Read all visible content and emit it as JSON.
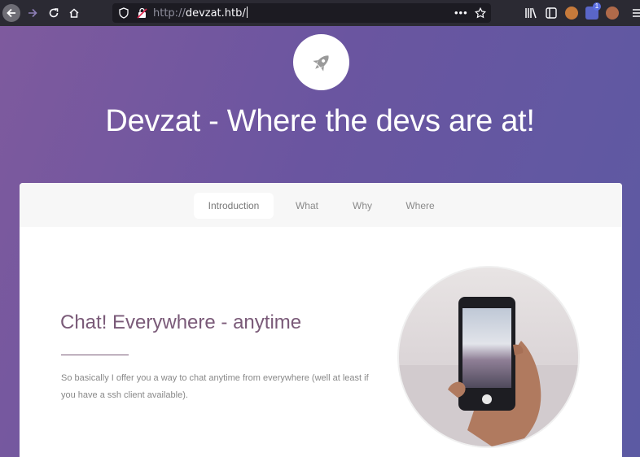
{
  "browser": {
    "url_protocol": "http://",
    "url_host": "devzat.htb/",
    "more_icon": "ellipsis-icon",
    "notification_badge": "1"
  },
  "hero": {
    "title": "Devzat - Where the devs are at!",
    "logo_icon": "rocket-icon"
  },
  "nav": {
    "tabs": [
      {
        "label": "Introduction",
        "active": true
      },
      {
        "label": "What"
      },
      {
        "label": "Why"
      },
      {
        "label": "Where"
      }
    ]
  },
  "intro": {
    "heading": "Chat! Everywhere - anytime",
    "body": "So basically I offer you a way to chat anytime from everywhere (well at least if you have a ssh client available)."
  },
  "colors": {
    "gradient_start": "#7e5a9e",
    "gradient_end": "#5c5aa3",
    "heading": "#7a5a78",
    "chrome": "#2b2a33"
  }
}
